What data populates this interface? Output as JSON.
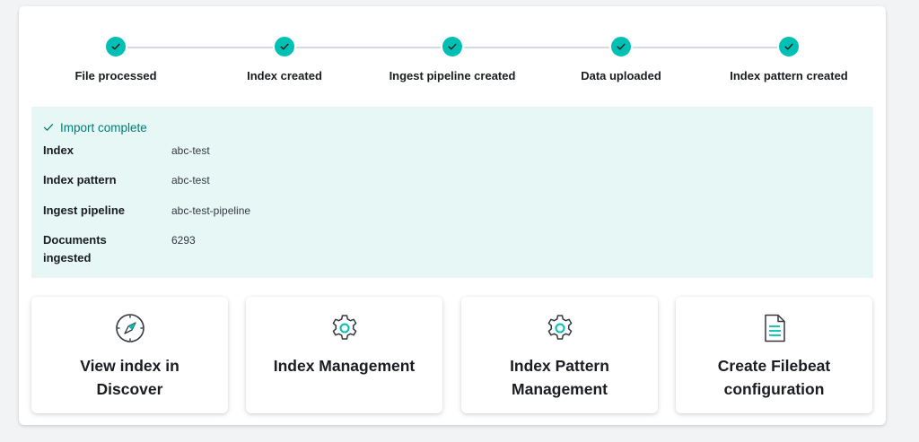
{
  "steps": [
    {
      "label": "File processed",
      "status": "complete"
    },
    {
      "label": "Index created",
      "status": "complete"
    },
    {
      "label": "Ingest pipeline created",
      "status": "complete"
    },
    {
      "label": "Data uploaded",
      "status": "complete"
    },
    {
      "label": "Index pattern created",
      "status": "complete"
    }
  ],
  "callout": {
    "title": "Import complete",
    "rows": [
      {
        "key": "Index",
        "value": "abc-test"
      },
      {
        "key": "Index pattern",
        "value": "abc-test"
      },
      {
        "key": "Ingest pipeline",
        "value": "abc-test-pipeline"
      },
      {
        "key": "Documents ingested",
        "value": "6293"
      }
    ]
  },
  "cards": [
    {
      "title": "View index in Discover",
      "icon": "compass-icon"
    },
    {
      "title": "Index Management",
      "icon": "gear-icon"
    },
    {
      "title": "Index Pattern Management",
      "icon": "gear-icon"
    },
    {
      "title": "Create Filebeat configuration",
      "icon": "document-icon"
    }
  ],
  "colors": {
    "accent": "#00bfb3",
    "success_bg": "#e6f7f5",
    "success_text": "#017d73",
    "text": "#1a1c21"
  }
}
